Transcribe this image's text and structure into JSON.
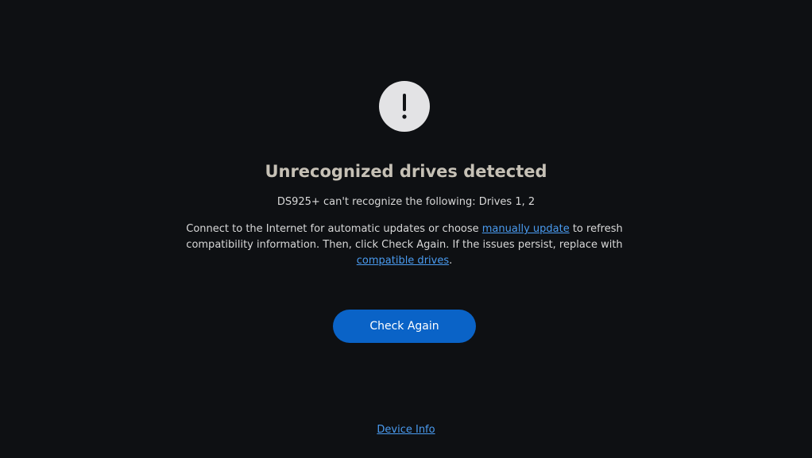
{
  "alert": {
    "icon": "exclamation-icon"
  },
  "title": "Unrecognized drives detected",
  "subtitle": "DS925+ can't recognize the following: Drives 1, 2",
  "description": {
    "part1": "Connect to the Internet for automatic updates or choose ",
    "link1": "manually update",
    "part2": " to refresh compatibility information. Then, click Check Again. If the issues persist, replace with ",
    "link2": "compatible drives",
    "part3": "."
  },
  "button": {
    "check_again_label": "Check Again"
  },
  "footer": {
    "device_info_label": "Device Info"
  },
  "colors": {
    "background": "#0e1013",
    "accent": "#0a63c7",
    "link": "#4a9bf0",
    "title": "#c6c1b6"
  }
}
